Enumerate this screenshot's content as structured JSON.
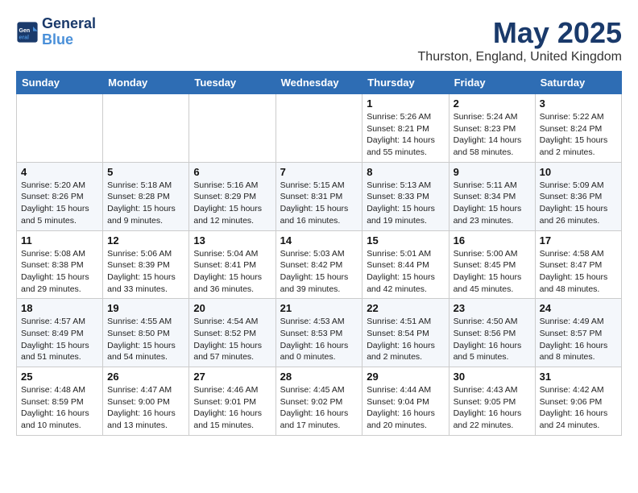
{
  "logo": {
    "line1": "General",
    "line2": "Blue"
  },
  "title": "May 2025",
  "location": "Thurston, England, United Kingdom",
  "weekdays": [
    "Sunday",
    "Monday",
    "Tuesday",
    "Wednesday",
    "Thursday",
    "Friday",
    "Saturday"
  ],
  "weeks": [
    [
      null,
      null,
      null,
      null,
      {
        "day": "1",
        "sunrise": "5:26 AM",
        "sunset": "8:21 PM",
        "daylight": "14 hours and 55 minutes."
      },
      {
        "day": "2",
        "sunrise": "5:24 AM",
        "sunset": "8:23 PM",
        "daylight": "14 hours and 58 minutes."
      },
      {
        "day": "3",
        "sunrise": "5:22 AM",
        "sunset": "8:24 PM",
        "daylight": "15 hours and 2 minutes."
      }
    ],
    [
      {
        "day": "4",
        "sunrise": "5:20 AM",
        "sunset": "8:26 PM",
        "daylight": "15 hours and 5 minutes."
      },
      {
        "day": "5",
        "sunrise": "5:18 AM",
        "sunset": "8:28 PM",
        "daylight": "15 hours and 9 minutes."
      },
      {
        "day": "6",
        "sunrise": "5:16 AM",
        "sunset": "8:29 PM",
        "daylight": "15 hours and 12 minutes."
      },
      {
        "day": "7",
        "sunrise": "5:15 AM",
        "sunset": "8:31 PM",
        "daylight": "15 hours and 16 minutes."
      },
      {
        "day": "8",
        "sunrise": "5:13 AM",
        "sunset": "8:33 PM",
        "daylight": "15 hours and 19 minutes."
      },
      {
        "day": "9",
        "sunrise": "5:11 AM",
        "sunset": "8:34 PM",
        "daylight": "15 hours and 23 minutes."
      },
      {
        "day": "10",
        "sunrise": "5:09 AM",
        "sunset": "8:36 PM",
        "daylight": "15 hours and 26 minutes."
      }
    ],
    [
      {
        "day": "11",
        "sunrise": "5:08 AM",
        "sunset": "8:38 PM",
        "daylight": "15 hours and 29 minutes."
      },
      {
        "day": "12",
        "sunrise": "5:06 AM",
        "sunset": "8:39 PM",
        "daylight": "15 hours and 33 minutes."
      },
      {
        "day": "13",
        "sunrise": "5:04 AM",
        "sunset": "8:41 PM",
        "daylight": "15 hours and 36 minutes."
      },
      {
        "day": "14",
        "sunrise": "5:03 AM",
        "sunset": "8:42 PM",
        "daylight": "15 hours and 39 minutes."
      },
      {
        "day": "15",
        "sunrise": "5:01 AM",
        "sunset": "8:44 PM",
        "daylight": "15 hours and 42 minutes."
      },
      {
        "day": "16",
        "sunrise": "5:00 AM",
        "sunset": "8:45 PM",
        "daylight": "15 hours and 45 minutes."
      },
      {
        "day": "17",
        "sunrise": "4:58 AM",
        "sunset": "8:47 PM",
        "daylight": "15 hours and 48 minutes."
      }
    ],
    [
      {
        "day": "18",
        "sunrise": "4:57 AM",
        "sunset": "8:49 PM",
        "daylight": "15 hours and 51 minutes."
      },
      {
        "day": "19",
        "sunrise": "4:55 AM",
        "sunset": "8:50 PM",
        "daylight": "15 hours and 54 minutes."
      },
      {
        "day": "20",
        "sunrise": "4:54 AM",
        "sunset": "8:52 PM",
        "daylight": "15 hours and 57 minutes."
      },
      {
        "day": "21",
        "sunrise": "4:53 AM",
        "sunset": "8:53 PM",
        "daylight": "16 hours and 0 minutes."
      },
      {
        "day": "22",
        "sunrise": "4:51 AM",
        "sunset": "8:54 PM",
        "daylight": "16 hours and 2 minutes."
      },
      {
        "day": "23",
        "sunrise": "4:50 AM",
        "sunset": "8:56 PM",
        "daylight": "16 hours and 5 minutes."
      },
      {
        "day": "24",
        "sunrise": "4:49 AM",
        "sunset": "8:57 PM",
        "daylight": "16 hours and 8 minutes."
      }
    ],
    [
      {
        "day": "25",
        "sunrise": "4:48 AM",
        "sunset": "8:59 PM",
        "daylight": "16 hours and 10 minutes."
      },
      {
        "day": "26",
        "sunrise": "4:47 AM",
        "sunset": "9:00 PM",
        "daylight": "16 hours and 13 minutes."
      },
      {
        "day": "27",
        "sunrise": "4:46 AM",
        "sunset": "9:01 PM",
        "daylight": "16 hours and 15 minutes."
      },
      {
        "day": "28",
        "sunrise": "4:45 AM",
        "sunset": "9:02 PM",
        "daylight": "16 hours and 17 minutes."
      },
      {
        "day": "29",
        "sunrise": "4:44 AM",
        "sunset": "9:04 PM",
        "daylight": "16 hours and 20 minutes."
      },
      {
        "day": "30",
        "sunrise": "4:43 AM",
        "sunset": "9:05 PM",
        "daylight": "16 hours and 22 minutes."
      },
      {
        "day": "31",
        "sunrise": "4:42 AM",
        "sunset": "9:06 PM",
        "daylight": "16 hours and 24 minutes."
      }
    ]
  ]
}
